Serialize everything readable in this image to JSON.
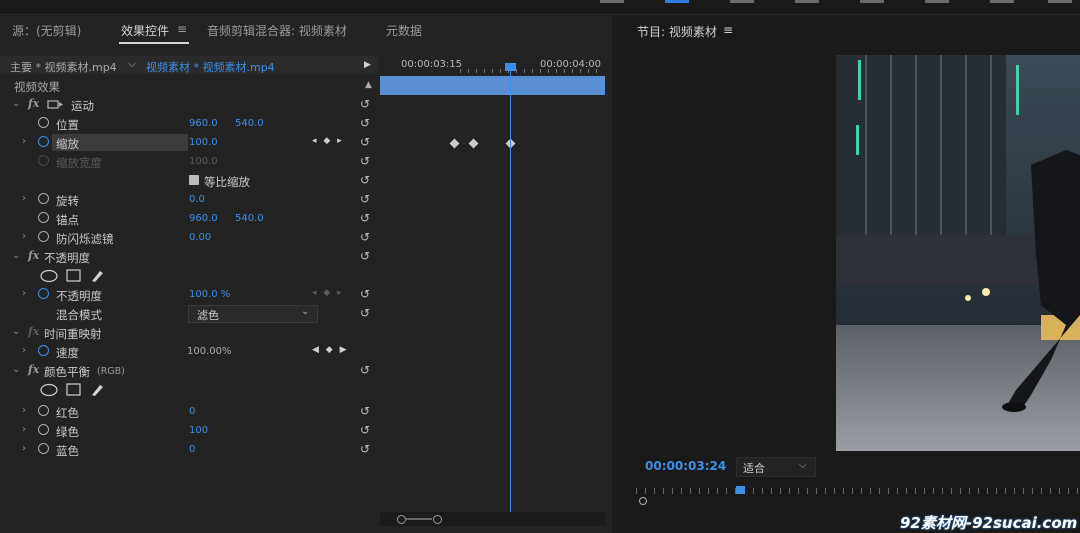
{
  "tabs": {
    "source": "源：(无剪辑)",
    "effect_controls": "效果控件",
    "menu_glyph": "≡",
    "audio_mixer": "音频剪辑混合器: 视频素材",
    "metadata": "元数据"
  },
  "clip_row": {
    "master": "主要 * 视频素材.mp4",
    "dropdown_glyph": "⌵",
    "sequence": "视频素材 * 视频素材.mp4",
    "play_glyph": "▶"
  },
  "timeline": {
    "time_start": "00:00:03:15",
    "time_end": "00:00:04:00"
  },
  "section_video": "视频效果",
  "motion": {
    "fx": "fx",
    "name": "运动",
    "position_label": "位置",
    "position_x": "960.0",
    "position_y": "540.0",
    "scale_label": "缩放",
    "scale_value": "100.0",
    "scale_width_label": "缩放宽度",
    "scale_width_value": "100.0",
    "uniform_label": "等比缩放",
    "rotation_label": "旋转",
    "rotation_value": "0.0",
    "anchor_label": "锚点",
    "anchor_x": "960.0",
    "anchor_y": "540.0",
    "antiflicker_label": "防闪烁滤镜",
    "antiflicker_value": "0.00"
  },
  "opacity": {
    "fx": "fx",
    "name": "不透明度",
    "opacity_label": "不透明度",
    "opacity_value": "100.0 %",
    "blend_label": "混合模式",
    "blend_value": "滤色"
  },
  "time_remap": {
    "fx": "fx",
    "name": "时间重映射",
    "speed_label": "速度",
    "speed_value": "100.00%"
  },
  "color_balance": {
    "fx": "fx",
    "name": "颜色平衡",
    "suffix": "(RGB)",
    "red_label": "红色",
    "red_value": "0",
    "green_label": "绿色",
    "green_value": "100",
    "blue_label": "蓝色",
    "blue_value": "0"
  },
  "program": {
    "title": "节目: 视频素材",
    "menu_glyph": "≡",
    "timecode": "00:00:03:24",
    "fit": "适合",
    "fit_glyph": "⌵"
  },
  "glyphs": {
    "reset": "↺",
    "chevron_right": "›",
    "chevron_down": "⌄",
    "kf_nav": "◀ ◆ ▶",
    "kf_nav_small": "◂ ◆ ▸",
    "up_arrow": "▲"
  },
  "watermark": "92素材网-92sucai.com",
  "colors": {
    "accent": "#3d8ee6",
    "timeline_bar": "#5b8fd3"
  }
}
